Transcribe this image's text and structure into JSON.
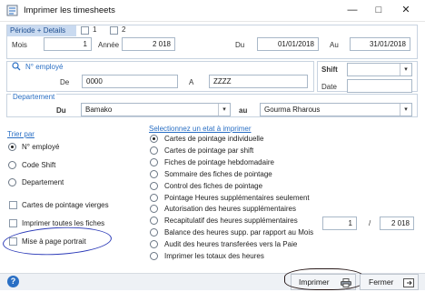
{
  "window": {
    "title": "Imprimer les timesheets",
    "minimize": "—",
    "maximize": "□",
    "close": "✕"
  },
  "periode": {
    "title": "Période + Details",
    "check1": "1",
    "check2": "2",
    "mois_label": "Mois",
    "mois_value": "1",
    "annee_label": "Année",
    "annee_value": "2 018",
    "du_label": "Du",
    "du_value": "01/01/2018",
    "au_label": "Au",
    "au_value": "31/01/2018"
  },
  "employe": {
    "title": "N° employé",
    "de_label": "De",
    "de_value": "0000",
    "a_label": "A",
    "a_value": "ZZZZ",
    "shift_label": "Shift",
    "shift_value": "",
    "date_label": "Date",
    "date_value": ""
  },
  "departement": {
    "title": "Departement",
    "du_label": "Du",
    "du_value": "Bamako",
    "au_label": "au",
    "au_value": "Gourma Rharous"
  },
  "trier": {
    "title": "Trier par",
    "options": [
      "N° employé",
      "Code Shift",
      "Departement"
    ],
    "selected": 0
  },
  "checkboxes": [
    "Cartes de pointage vierges",
    "Imprimer toutes les fiches",
    "Mise à page portrait"
  ],
  "etats": {
    "title": "Selectionnez un etat à imprimer",
    "items": [
      "Cartes de pointage individuelle",
      "Cartes de pointage par shift",
      "Fiches de pointage hebdomadaire",
      "Sommaire des fiches de pointage",
      "Control des fiches de pointage",
      "Pointage Heures supplémentaires seulement",
      "Autorisation des heures supplémentaires",
      "Recapitulatif des heures supplémentaires",
      "Balance des heures supp. par rapport au Mois",
      "Audit des heures transferées vers la Paie",
      "Imprimer les totaux des heures"
    ],
    "selected": 0,
    "recap_value1": "1",
    "recap_sep": "/",
    "recap_value2": "2 018"
  },
  "footer": {
    "help": "?",
    "imprimer": "Imprimer",
    "fermer": "Fermer"
  },
  "colors": {
    "accent": "#2a6fc4",
    "annotation_blue": "#2b3ab8",
    "annotation_dark": "#2a1b1b"
  }
}
